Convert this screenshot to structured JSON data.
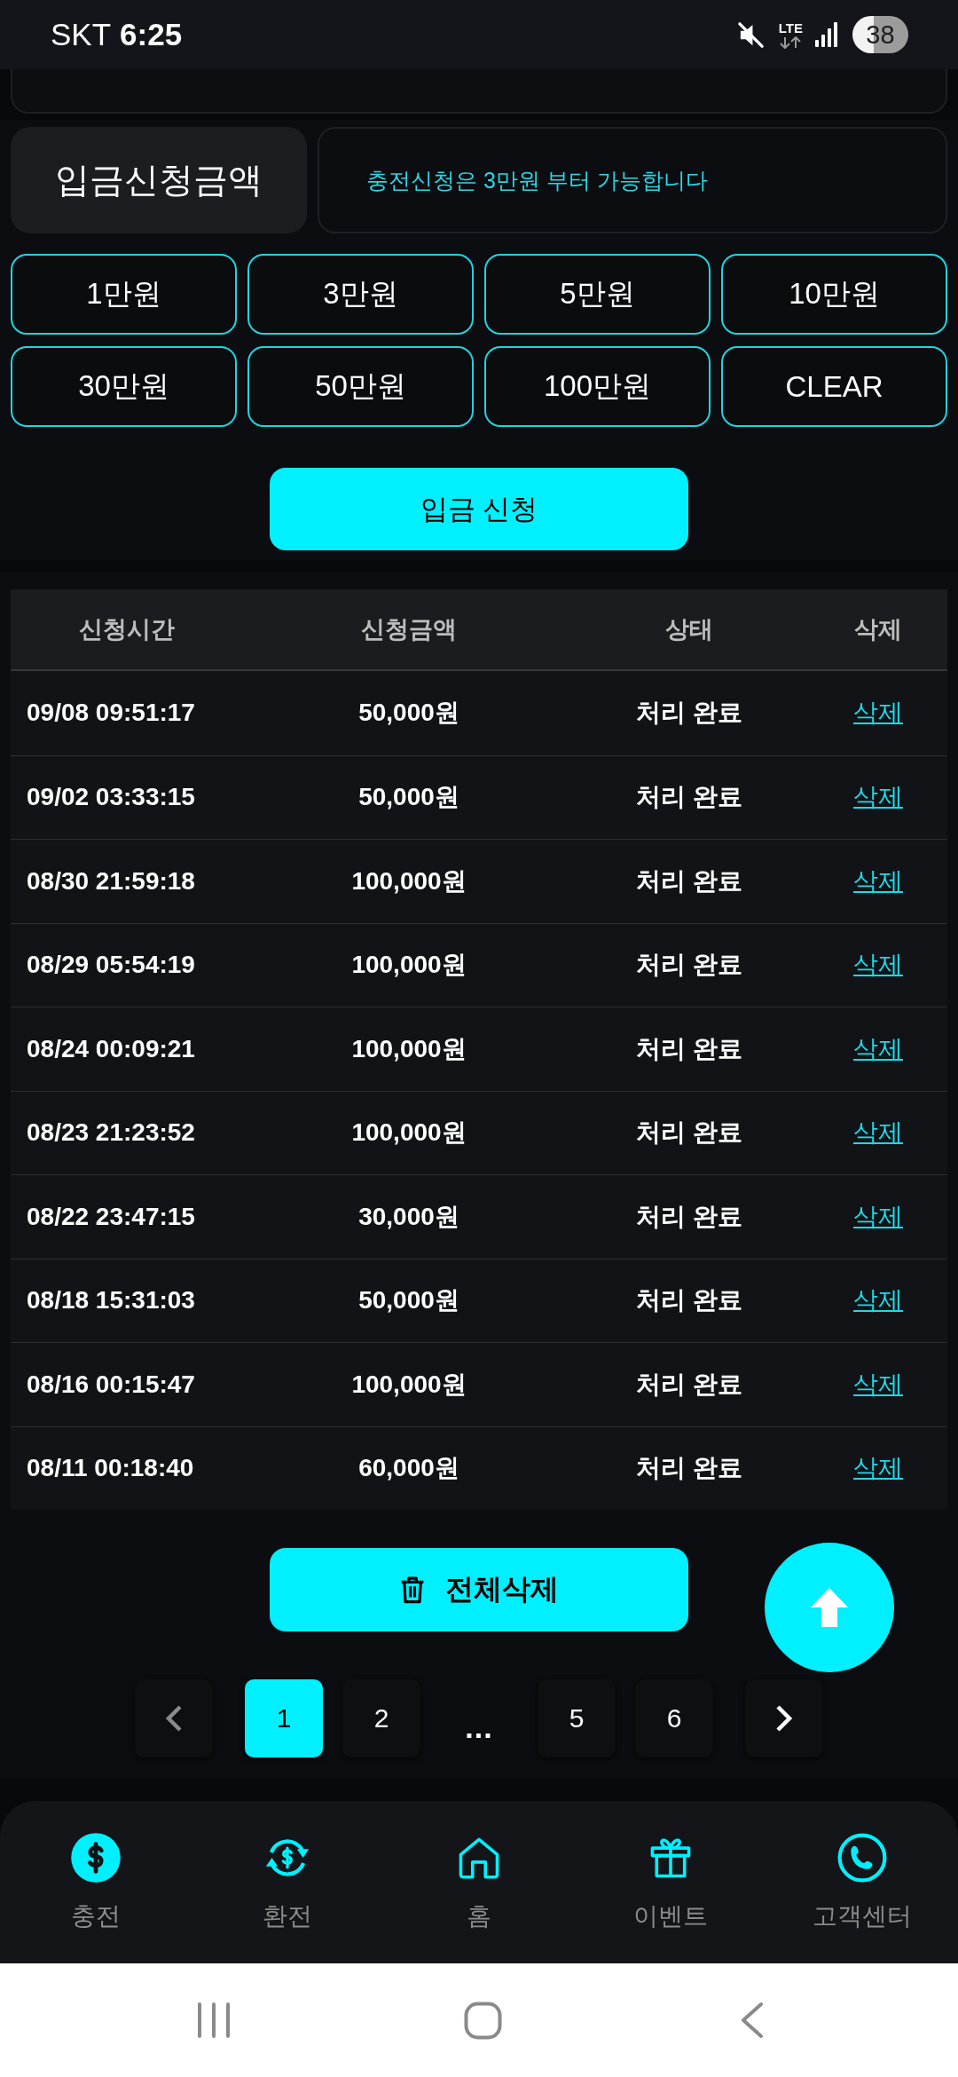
{
  "status_bar": {
    "carrier": "SKT",
    "time": "6:25",
    "network": "LTE",
    "battery": "38"
  },
  "deposit_form": {
    "label": "입금신청금액",
    "notice": "충전신청은 3만원 부터 가능합니다",
    "amount_buttons": [
      "1만원",
      "3만원",
      "5만원",
      "10만원",
      "30만원",
      "50만원",
      "100만원",
      "CLEAR"
    ],
    "submit_button": "입금 신청"
  },
  "history_table": {
    "columns": [
      "신청시간",
      "신청금액",
      "상태",
      "삭제"
    ],
    "rows": [
      {
        "time": "09/08 09:51:17",
        "amount": "50,000원",
        "status": "처리 완료",
        "action": "삭제"
      },
      {
        "time": "09/02 03:33:15",
        "amount": "50,000원",
        "status": "처리 완료",
        "action": "삭제"
      },
      {
        "time": "08/30 21:59:18",
        "amount": "100,000원",
        "status": "처리 완료",
        "action": "삭제"
      },
      {
        "time": "08/29 05:54:19",
        "amount": "100,000원",
        "status": "처리 완료",
        "action": "삭제"
      },
      {
        "time": "08/24 00:09:21",
        "amount": "100,000원",
        "status": "처리 완료",
        "action": "삭제"
      },
      {
        "time": "08/23 21:23:52",
        "amount": "100,000원",
        "status": "처리 완료",
        "action": "삭제"
      },
      {
        "time": "08/22 23:47:15",
        "amount": "30,000원",
        "status": "처리 완료",
        "action": "삭제"
      },
      {
        "time": "08/18 15:31:03",
        "amount": "50,000원",
        "status": "처리 완료",
        "action": "삭제"
      },
      {
        "time": "08/16 00:15:47",
        "amount": "100,000원",
        "status": "처리 완료",
        "action": "삭제"
      },
      {
        "time": "08/11 00:18:40",
        "amount": "60,000원",
        "status": "처리 완료",
        "action": "삭제"
      }
    ]
  },
  "delete_all_button": "전체삭제",
  "pagination": {
    "prev": {
      "disabled": true
    },
    "next": {
      "disabled": false
    },
    "pages": [
      {
        "kind": "page",
        "label": "1",
        "selected": true
      },
      {
        "kind": "page",
        "label": "2",
        "selected": false
      },
      {
        "kind": "gap",
        "label": "...",
        "selected": false
      },
      {
        "kind": "page",
        "label": "5",
        "selected": false
      },
      {
        "kind": "page",
        "label": "6",
        "selected": false
      }
    ]
  },
  "bottom_nav": [
    {
      "label": "충전",
      "selected": true
    },
    {
      "label": "환전",
      "selected": false
    },
    {
      "label": "홈",
      "selected": false
    },
    {
      "label": "이벤트",
      "selected": false
    },
    {
      "label": "고객센터",
      "selected": false
    }
  ]
}
